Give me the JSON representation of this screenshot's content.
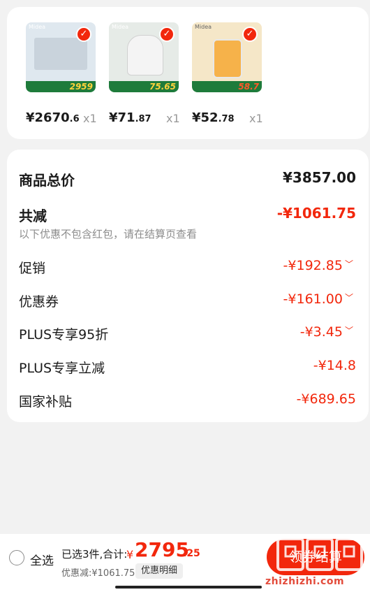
{
  "products": [
    {
      "brand": "Midea",
      "band_price": "2959",
      "price_int": "¥2670",
      "price_dec": ".6",
      "qty": "x1",
      "img_color": "#dfe8ef"
    },
    {
      "brand": "Midea",
      "band_price": "75.65",
      "price_int": "¥71",
      "price_dec": ".87",
      "qty": "x1",
      "img_color": "#e6ebe7"
    },
    {
      "brand": "Midea",
      "band_price": "58.7",
      "price_int": "¥52",
      "price_dec": ".78",
      "qty": "x1",
      "img_color": "#f5e7c8"
    }
  ],
  "summary": {
    "goods_total_label": "商品总价",
    "goods_total_value": "¥3857.00",
    "total_discount_label": "共减",
    "total_discount_value": "-¥1061.75",
    "note": "以下优惠不包含红包，请在结算页查看",
    "promo_label": "促销",
    "promo_value": "-¥192.85",
    "coupon_label": "优惠券",
    "coupon_value": "-¥161.00",
    "plus95_label": "PLUS专享95折",
    "plus95_value": "-¥3.45",
    "plus_reduce_label": "PLUS专享立减",
    "plus_reduce_value": "-¥14.8",
    "subsidy_label": "国家补贴",
    "subsidy_value": "-¥689.65"
  },
  "bottom": {
    "select_all": "全选",
    "selected_info": "已选3件,合计:",
    "currency": "¥",
    "total_int": "2795",
    "total_dec": ".25",
    "discount_text": "优惠减:¥1061.75",
    "discount_detail": "优惠明细",
    "checkout": "领券结算",
    "watermark": "zhizhizhi.com"
  },
  "colors": {
    "accent": "#f2270c",
    "background": "#f2f2f2",
    "muted": "#8c8c8c"
  },
  "icons": {
    "check": "check-icon",
    "chevron": "chevron-down-icon",
    "radio": "radio-unchecked-icon"
  }
}
